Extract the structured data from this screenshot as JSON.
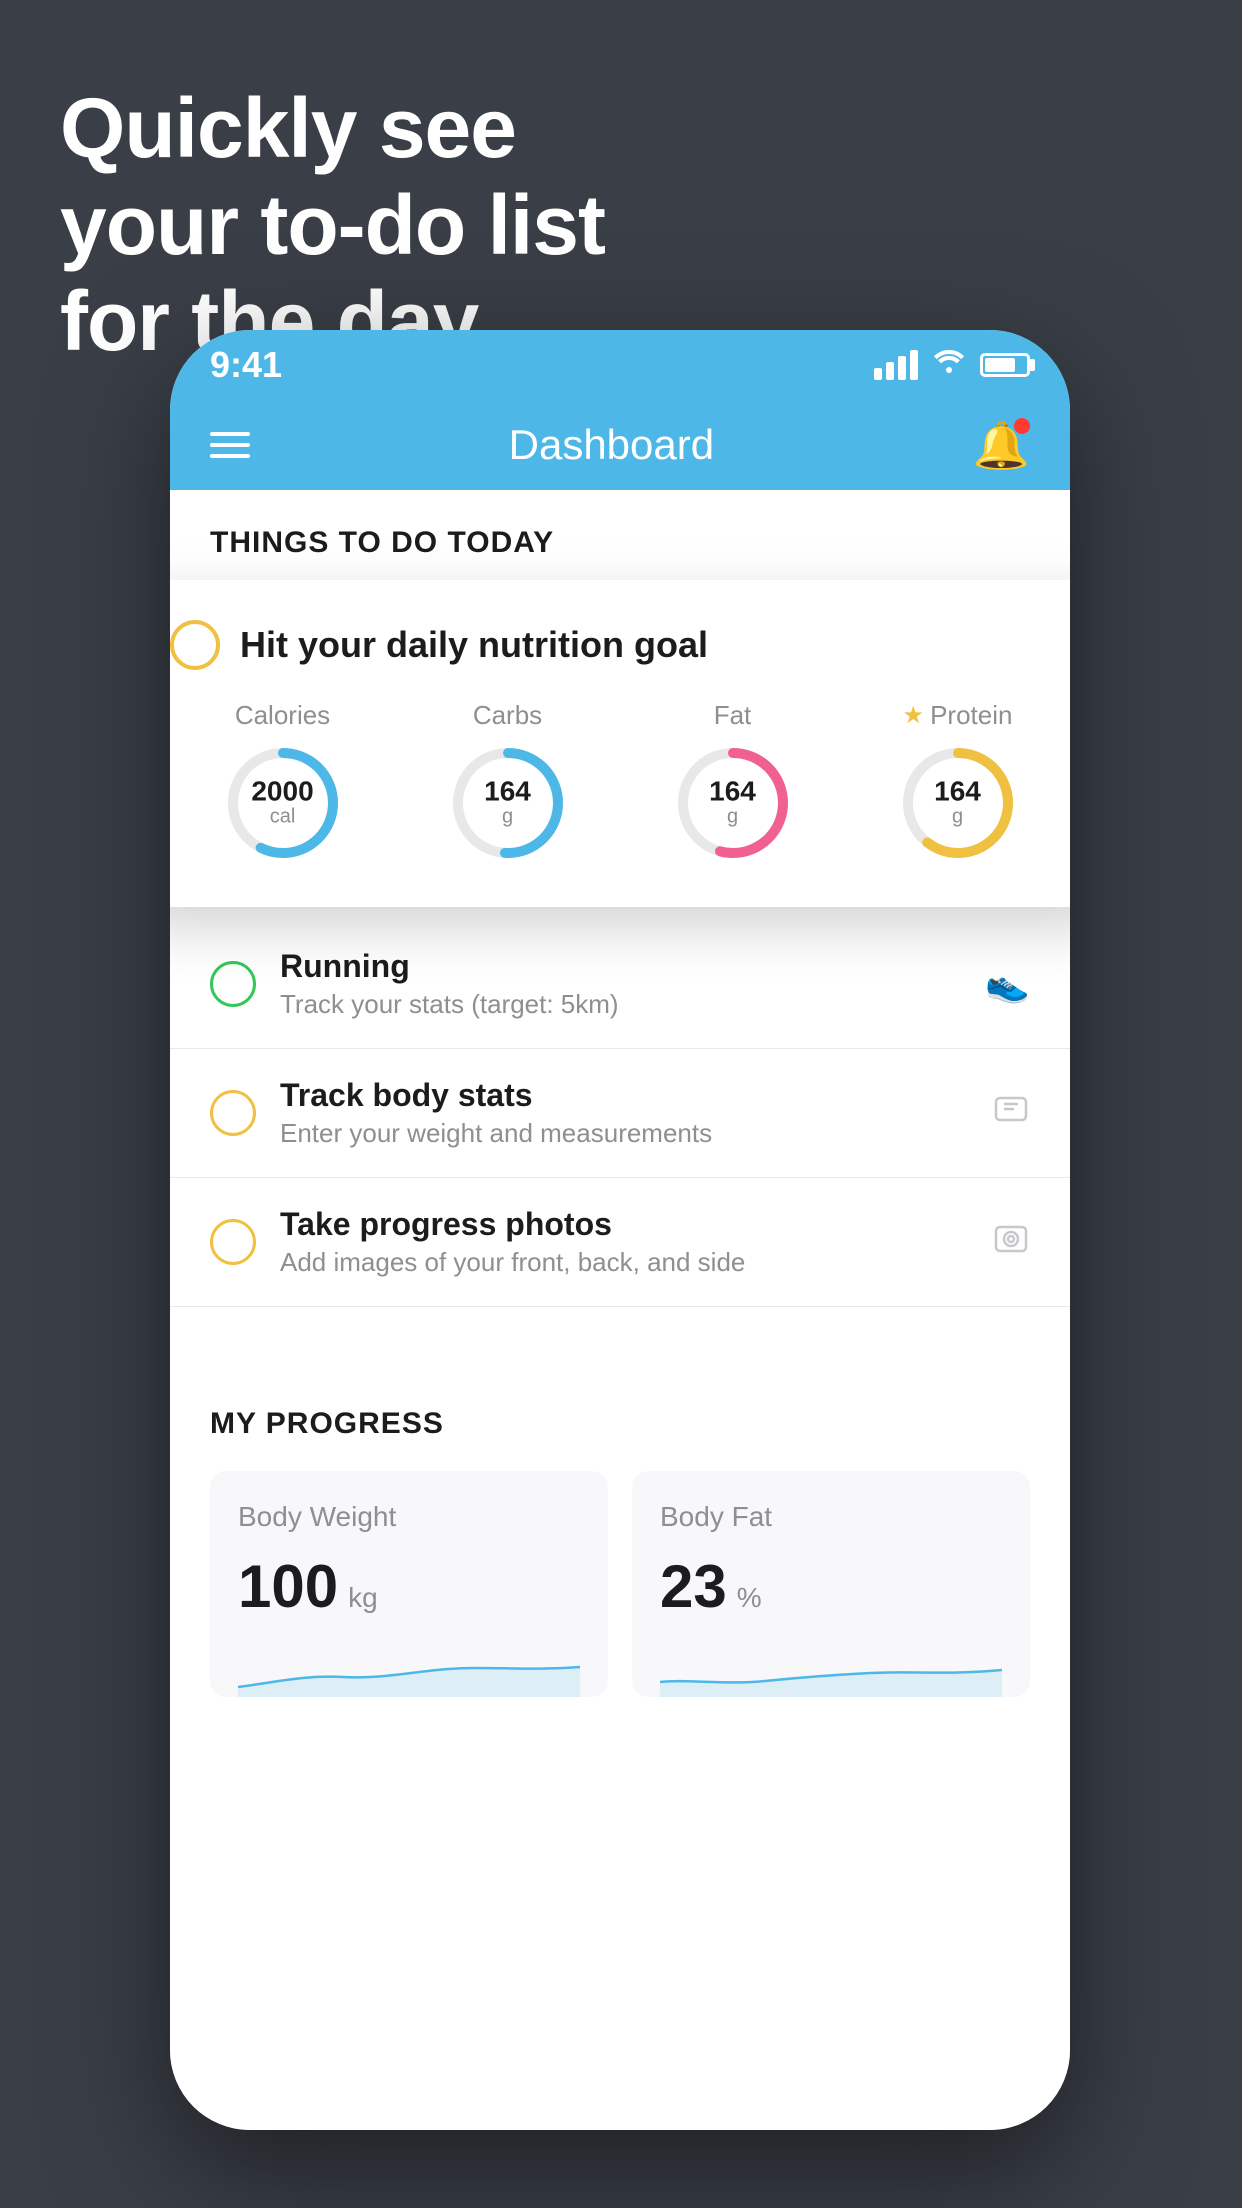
{
  "headline": {
    "line1": "Quickly see",
    "line2": "your to-do list",
    "line3": "for the day."
  },
  "statusBar": {
    "time": "9:41"
  },
  "navBar": {
    "title": "Dashboard"
  },
  "thingsTodo": {
    "sectionTitle": "THINGS TO DO TODAY"
  },
  "floatingCard": {
    "circleColor": "yellow",
    "title": "Hit your daily nutrition goal",
    "items": [
      {
        "label": "Calories",
        "value": "2000",
        "unit": "cal",
        "type": "calories"
      },
      {
        "label": "Carbs",
        "value": "164",
        "unit": "g",
        "type": "carbs"
      },
      {
        "label": "Fat",
        "value": "164",
        "unit": "g",
        "type": "fat"
      },
      {
        "label": "Protein",
        "value": "164",
        "unit": "g",
        "type": "protein",
        "star": true
      }
    ]
  },
  "todoItems": [
    {
      "title": "Running",
      "subtitle": "Track your stats (target: 5km)",
      "circleColor": "green",
      "icon": "🏃"
    },
    {
      "title": "Track body stats",
      "subtitle": "Enter your weight and measurements",
      "circleColor": "yellow",
      "icon": "⚖"
    },
    {
      "title": "Take progress photos",
      "subtitle": "Add images of your front, back, and side",
      "circleColor": "yellow",
      "icon": "🖼"
    }
  ],
  "myProgress": {
    "sectionTitle": "MY PROGRESS",
    "cards": [
      {
        "title": "Body Weight",
        "value": "100",
        "unit": "kg"
      },
      {
        "title": "Body Fat",
        "value": "23",
        "unit": "%"
      }
    ]
  }
}
